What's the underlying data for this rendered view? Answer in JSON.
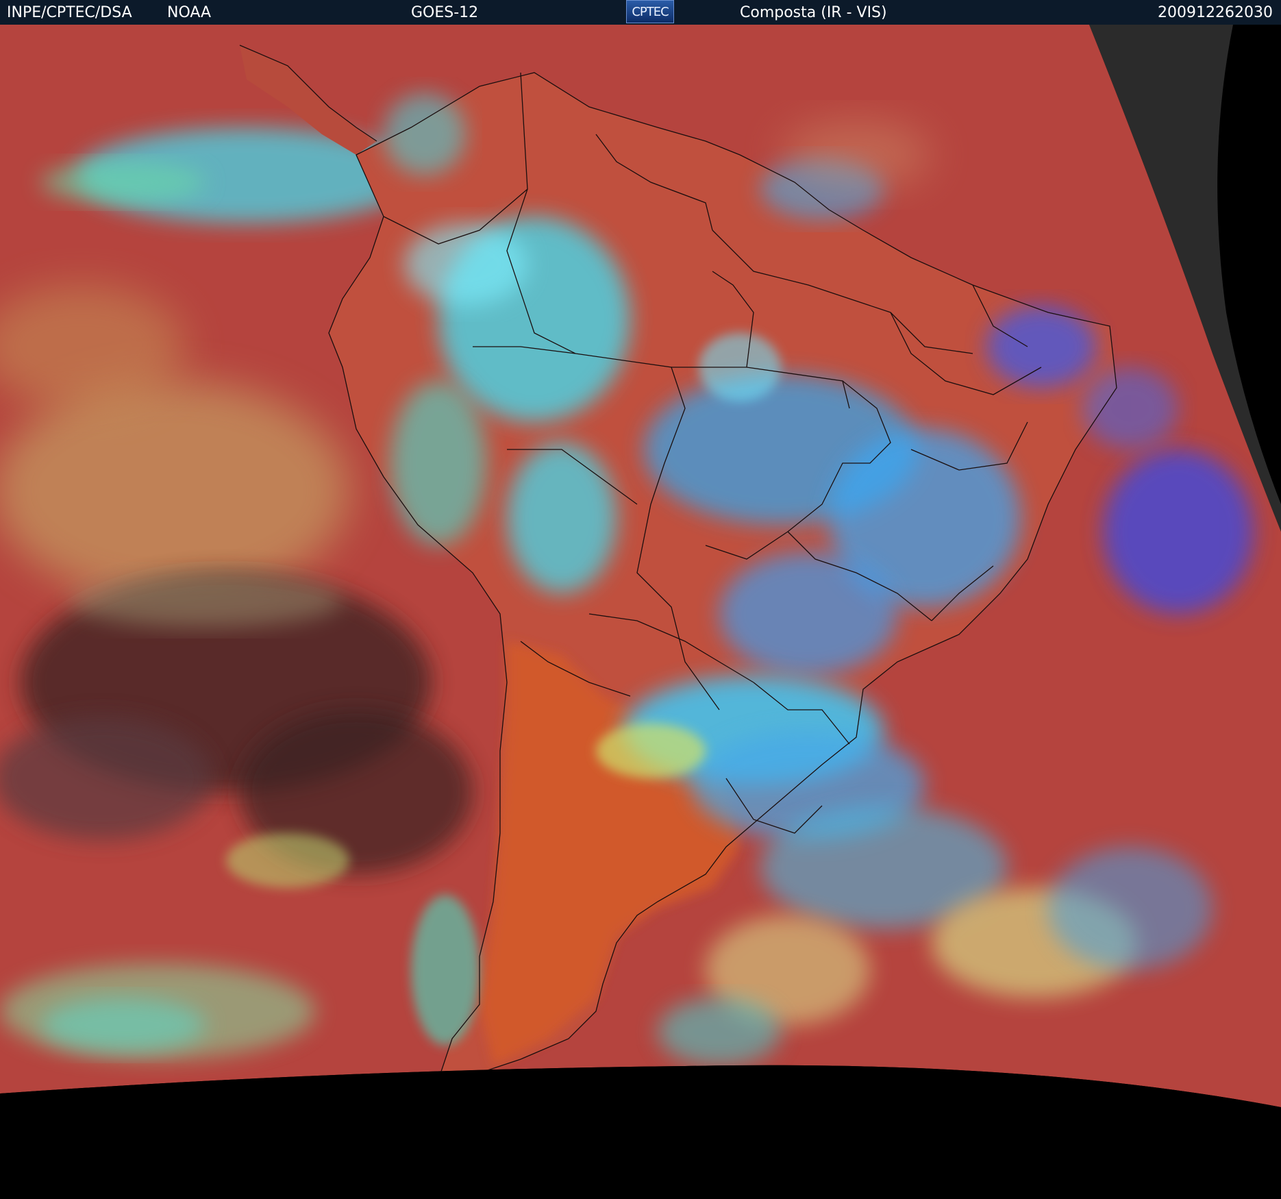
{
  "header": {
    "source": "INPE/CPTEC/DSA",
    "agency": "NOAA",
    "satellite": "GOES-12",
    "logo_text": "CPTEC",
    "product": "Composta (IR - VIS)",
    "timestamp": "200912262030"
  },
  "colors": {
    "ocean": "#b5443e",
    "land": "#c0503e",
    "clear_land_orange": "#d35a2c",
    "cloud_cyan": "#3fe0f5",
    "cloud_blue": "#3a5cf0",
    "low_cloud_yellow": "#cbd26a",
    "shadow": "#2a1a1a",
    "space": "#000000",
    "night_disk": "#2b2b2b"
  }
}
